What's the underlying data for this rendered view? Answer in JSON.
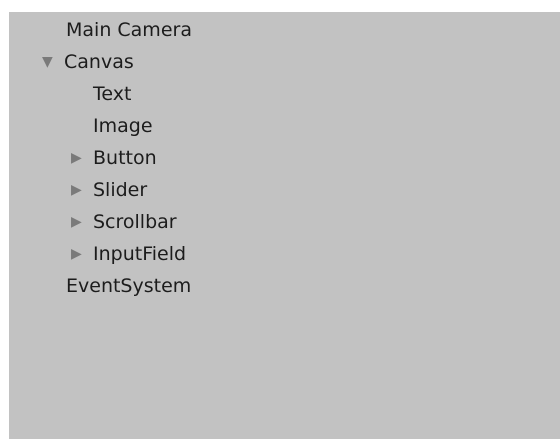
{
  "hierarchy": {
    "items": [
      {
        "label": "Main Camera",
        "depth": 0,
        "expander": "none"
      },
      {
        "label": "Canvas",
        "depth": 0,
        "expander": "expanded",
        "expander_icon": "triangle-down-icon"
      },
      {
        "label": "Text",
        "depth": 1,
        "expander": "none"
      },
      {
        "label": "Image",
        "depth": 1,
        "expander": "none"
      },
      {
        "label": "Button",
        "depth": 1,
        "expander": "collapsed",
        "expander_icon": "triangle-right-icon"
      },
      {
        "label": "Slider",
        "depth": 1,
        "expander": "collapsed",
        "expander_icon": "triangle-right-icon"
      },
      {
        "label": "Scrollbar",
        "depth": 1,
        "expander": "collapsed",
        "expander_icon": "triangle-right-icon"
      },
      {
        "label": "InputField",
        "depth": 1,
        "expander": "collapsed",
        "expander_icon": "triangle-right-icon"
      },
      {
        "label": "EventSystem",
        "depth": 0,
        "expander": "none"
      }
    ]
  },
  "colors": {
    "panel_background": "#c2c2c2",
    "text": "#1c1c1c",
    "expander_arrow": "#7a7a7a"
  }
}
